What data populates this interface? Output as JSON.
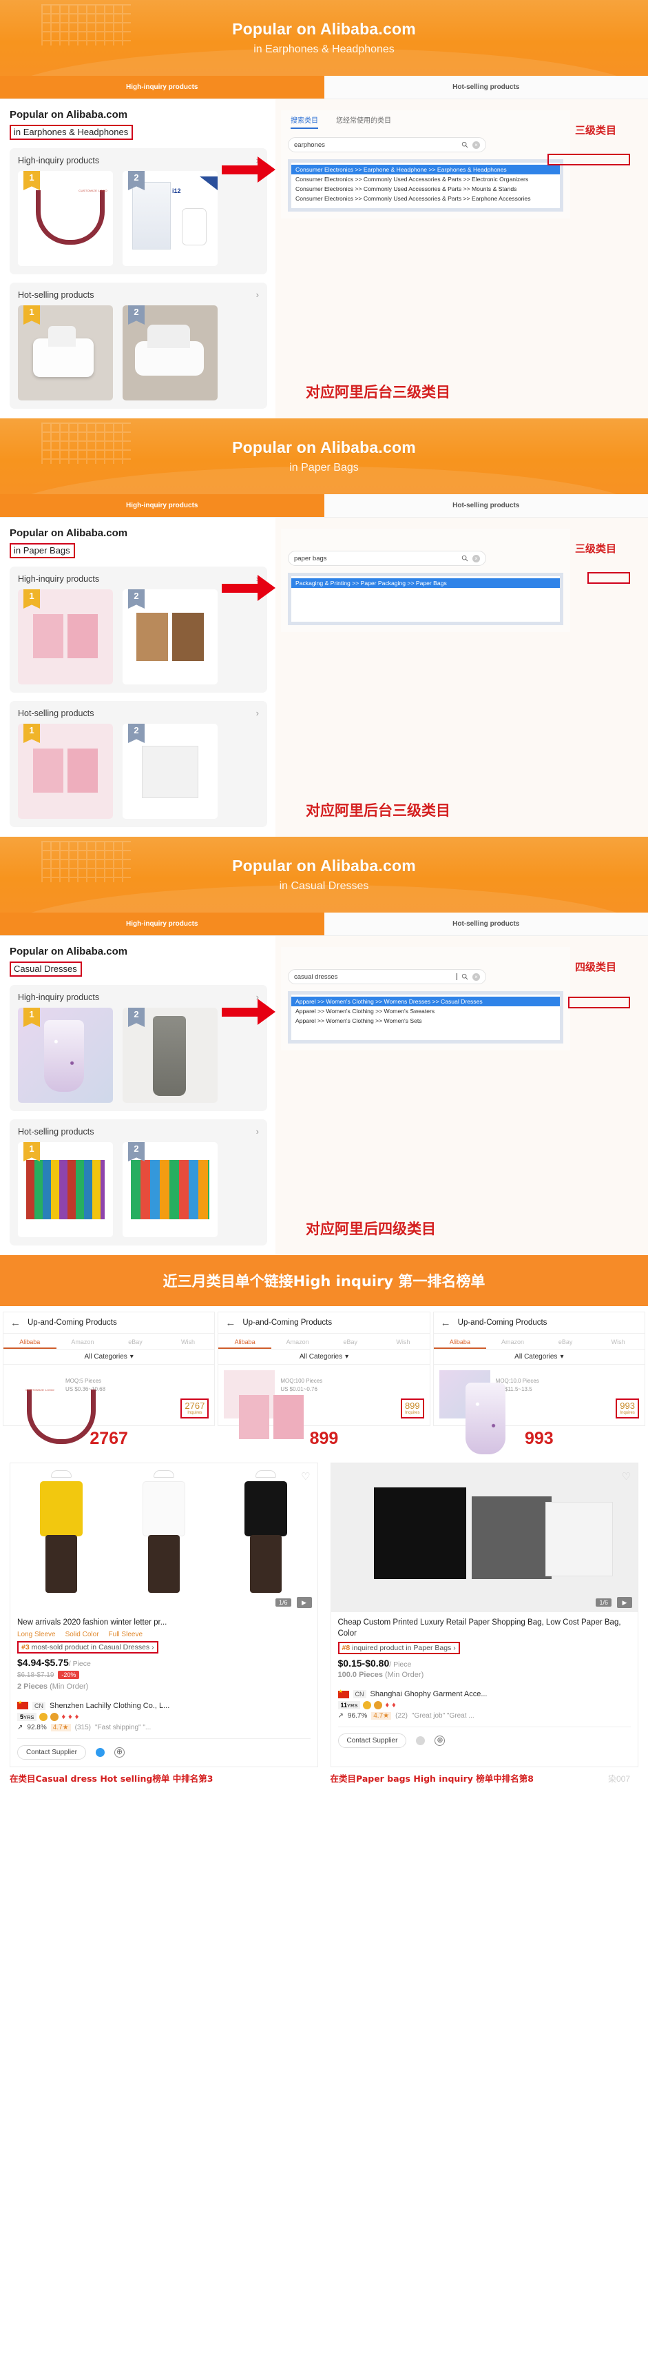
{
  "sections": [
    {
      "banner_title": "Popular on Alibaba.com",
      "banner_sub": "in Earphones & Headphones",
      "tabs": [
        {
          "label": "High-inquiry products",
          "active": true
        },
        {
          "label": "Hot-selling products",
          "active": false
        }
      ],
      "page_title": "Popular on Alibaba.com",
      "page_sub": "in Earphones & Headphones",
      "boxes": [
        {
          "title": "High-inquiry products",
          "chevron": "›",
          "products": [
            {
              "rank": "1",
              "style": "neckband"
            },
            {
              "rank": "2",
              "style": "earbud-box",
              "badge": "i12"
            }
          ]
        },
        {
          "title": "Hot-selling products",
          "chevron": "›",
          "products": [
            {
              "rank": "1",
              "style": "airpods"
            },
            {
              "rank": "2",
              "style": "airpods-pro"
            }
          ]
        }
      ],
      "cat_tabs": [
        {
          "label": "搜索类目",
          "active": true
        },
        {
          "label": "您经常使用的类目",
          "active": false
        }
      ],
      "search_value": "earphones",
      "search_caret": false,
      "results": [
        {
          "text": "Consumer Electronics >> Earphone & Headphone >> Earphones & Headphones",
          "selected": true,
          "boxed_tail": "Earphones & Headphones"
        },
        {
          "text": "Consumer Electronics >> Commonly Used Accessories & Parts >> Electronic Organizers",
          "selected": false
        },
        {
          "text": "Consumer Electronics >> Commonly Used Accessories & Parts >> Mounts & Stands",
          "selected": false
        },
        {
          "text": "Consumer Electronics >> Commonly Used Accessories & Parts >> Earphone Accessories",
          "selected": false
        }
      ],
      "level_note": "三级类目",
      "big_note": "对应阿里后台三级类目"
    },
    {
      "banner_title": "Popular on Alibaba.com",
      "banner_sub": "in Paper Bags",
      "tabs": [
        {
          "label": "High-inquiry products",
          "active": true
        },
        {
          "label": "Hot-selling products",
          "active": false
        }
      ],
      "page_title": "Popular on Alibaba.com",
      "page_sub": "in Paper Bags",
      "boxes": [
        {
          "title": "High-inquiry products",
          "chevron": "›",
          "products": [
            {
              "rank": "1",
              "style": "pinkbag"
            },
            {
              "rank": "2",
              "style": "kraftbag"
            }
          ]
        },
        {
          "title": "Hot-selling products",
          "chevron": "›",
          "products": [
            {
              "rank": "1",
              "style": "pinkbag"
            },
            {
              "rank": "2",
              "style": "whitebag"
            }
          ]
        }
      ],
      "cat_tabs": [],
      "search_value": "paper bags",
      "search_caret": false,
      "results": [
        {
          "text": "Packaging & Printing >> Paper Packaging >> Paper Bags",
          "selected": true,
          "boxed_tail": "Paper Bags"
        }
      ],
      "level_note": "三级类目",
      "big_note": "对应阿里后台三级类目"
    },
    {
      "banner_title": "Popular on Alibaba.com",
      "banner_sub": "in Casual Dresses",
      "tabs": [
        {
          "label": "High-inquiry products",
          "active": true
        },
        {
          "label": "Hot-selling products",
          "active": false
        }
      ],
      "page_title": "Popular on Alibaba.com",
      "page_sub": "Casual Dresses",
      "boxes": [
        {
          "title": "High-inquiry products",
          "chevron": "›",
          "products": [
            {
              "rank": "1",
              "style": "dressfloral"
            },
            {
              "rank": "2",
              "style": "dressgrey"
            }
          ]
        },
        {
          "title": "Hot-selling products",
          "chevron": "›",
          "products": [
            {
              "rank": "1",
              "style": "dressrow"
            },
            {
              "rank": "2",
              "style": "dressgreen"
            }
          ]
        }
      ],
      "cat_tabs": [],
      "search_value": "casual dresses",
      "search_caret": true,
      "results": [
        {
          "text": "Apparel >> Women's Clothing >> Womens Dresses >> Casual Dresses",
          "selected": true,
          "boxed_tail": "Casual Dresses"
        },
        {
          "text": "Apparel >> Women's Clothing >> Women's Sweaters",
          "selected": false
        },
        {
          "text": "Apparel >> Women's Clothing >> Women's Sets",
          "selected": false
        }
      ],
      "level_note": "四级类目",
      "big_note": "对应阿里后四级类目"
    }
  ],
  "wide_banner": "近三月类目单个链接High inquiry 第一排名榜单",
  "uac_panels": [
    {
      "title": "Up-and-Coming Products",
      "back_icon": "←",
      "tabs": [
        {
          "label": "Alibaba",
          "active": true
        },
        {
          "label": "Amazon",
          "active": false
        },
        {
          "label": "eBay",
          "active": false
        },
        {
          "label": "Wish",
          "active": false
        }
      ],
      "category": "All Categories",
      "caret": "▾",
      "moq": "MOQ:5 Pieces",
      "price": "US $0.36~10.68",
      "inquiries": "2767",
      "inquiries_unit": "Inquires",
      "thumb": "neckband",
      "bignum": "2767"
    },
    {
      "title": "Up-and-Coming Products",
      "back_icon": "←",
      "tabs": [
        {
          "label": "Alibaba",
          "active": true
        },
        {
          "label": "Amazon",
          "active": false
        },
        {
          "label": "eBay",
          "active": false
        },
        {
          "label": "Wish",
          "active": false
        }
      ],
      "category": "All Categories",
      "caret": "▾",
      "moq": "MOQ:100 Pieces",
      "price": "US $0.01~0.76",
      "inquiries": "899",
      "inquiries_unit": "Inquires",
      "thumb": "pinkbag",
      "bignum": "899"
    },
    {
      "title": "Up-and-Coming Products",
      "back_icon": "←",
      "tabs": [
        {
          "label": "Alibaba",
          "active": true
        },
        {
          "label": "Amazon",
          "active": false
        },
        {
          "label": "eBay",
          "active": false
        },
        {
          "label": "Wish",
          "active": false
        }
      ],
      "category": "All Categories",
      "caret": "▾",
      "moq": "MOQ:10.0 Pieces",
      "price": "US $11.5~13.5",
      "inquiries": "993",
      "inquiries_unit": "Inquires",
      "thumb": "dressfloral",
      "bignum": "993"
    }
  ],
  "detail_cards": [
    {
      "image_style": "tshirts",
      "image_count": "1/6",
      "play_icon": "▶",
      "heart_icon": "♡",
      "title": "New arrivals 2020 fashion winter letter pr...",
      "tags": [
        "Long Sleeve",
        "Solid Color",
        "Full Sleeve"
      ],
      "rank_hash": "#3",
      "rank_text": "most-sold product in Casual Dresses",
      "rank_chevron": "›",
      "price": "$4.94-$5.75",
      "price_unit": "/ Piece",
      "old_price": "$6.18-$7.19",
      "discount": "-20%",
      "min_order_qty": "2 Pieces",
      "min_order_label": "(Min Order)",
      "country": "CN",
      "supplier": "Shenzhen Lachilly Clothing Co., L...",
      "years": "5",
      "years_unit": "YRS",
      "gems": 3,
      "response_rate": "92.8%",
      "score": "4.7",
      "star": "★",
      "review_count": "(315)",
      "review_quotes": "\"Fast shipping\"  \"...",
      "contact_label": "Contact Supplier",
      "plus_icon": "⊕",
      "note": "在类目Casual dress  Hot selling榜单 中排名第3"
    },
    {
      "image_style": "bagphoto",
      "image_count": "1/6",
      "play_icon": "▶",
      "heart_icon": "♡",
      "title_parts": "Cheap Custom Printed Luxury Retail Paper Shopping Bag, Low Cost Paper Bag, Color",
      "title": "Cheap Custom Printed Luxury Retail Paper Shopping Bag, Low Cost Paper Bag, Color",
      "tags": [],
      "rank_hash": "#8",
      "rank_text": "inquired product in Paper Bags",
      "rank_chevron": "›",
      "price": "$0.15-$0.80",
      "price_unit": "/ Piece",
      "old_price": "",
      "discount": "",
      "min_order_qty": "100.0 Pieces",
      "min_order_label": "(Min Order)",
      "country": "CN",
      "supplier": "Shanghai Ghophy Garment Acce...",
      "years": "11",
      "years_unit": "YRS",
      "gems": 2,
      "response_rate": "96.7%",
      "score": "4.7",
      "star": "★",
      "review_count": "(22)",
      "review_quotes": "\"Great job\"  \"Great ...",
      "contact_label": "Contact Supplier",
      "plus_icon": "⊕",
      "note": "在类目Paper bags  High inquiry 榜单中排名第8"
    }
  ],
  "watermark": "染007",
  "colors": {
    "orange": "#f68b1f",
    "red": "#d0021b",
    "blue_select": "#2f83e8",
    "note_red": "#d41f1f"
  }
}
